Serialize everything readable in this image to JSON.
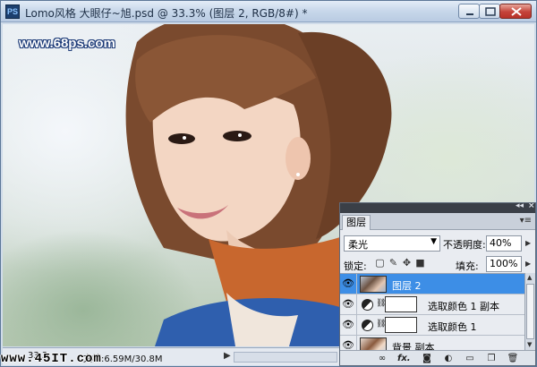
{
  "window": {
    "app_icon": "PS",
    "title": "Lomo风格  大眼仔~旭.psd @ 33.3% (图层 2, RGB/8#) *",
    "buttons": [
      "minimize-icon",
      "maximize-icon",
      "close-icon"
    ]
  },
  "canvas": {
    "watermark": "www.68ps.com"
  },
  "status_bar": {
    "zoom": "33.3",
    "doc_info": "文档:6.59M/30.8M"
  },
  "brand_watermark": "www.45IT.com",
  "layers_panel": {
    "tab_label": "图层",
    "blend_mode": "柔光",
    "opacity_label": "不透明度:",
    "opacity_value": "40%",
    "lock_label": "锁定:",
    "fill_label": "填充:",
    "fill_value": "100%",
    "layers": [
      {
        "name": "图层 2",
        "selected": true,
        "type": "pixel"
      },
      {
        "name": "选取颜色 1 副本",
        "selected": false,
        "type": "adjustment"
      },
      {
        "name": "选取颜色 1",
        "selected": false,
        "type": "adjustment"
      },
      {
        "name": "背景 副本",
        "selected": false,
        "type": "pixel"
      }
    ],
    "footer_icons": [
      "link-icon",
      "fx-icon",
      "mask-icon",
      "adjustment-icon",
      "folder-icon",
      "new-layer-icon",
      "trash-icon"
    ],
    "footer_fx": "fx."
  },
  "colors": {
    "selection": "#3d8ee6",
    "title_bar": "#c7d7ea",
    "watermark_outline": "#1d3b78"
  }
}
